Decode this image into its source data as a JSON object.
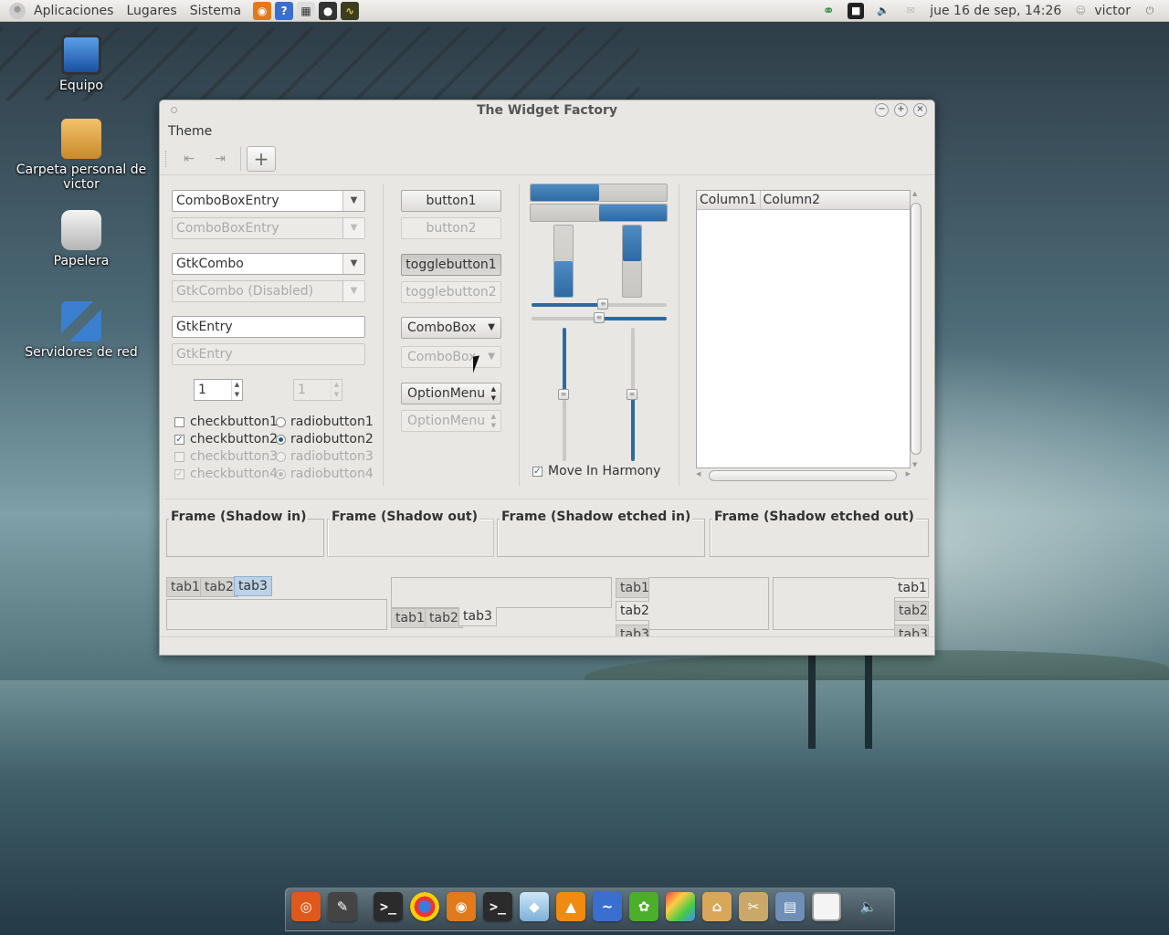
{
  "top_panel": {
    "menus": [
      "Aplicaciones",
      "Lugares",
      "Sistema"
    ],
    "datetime": "jue 16 de sep, 14:26",
    "user": "victor"
  },
  "desktop": {
    "icons": [
      {
        "label": "Equipo"
      },
      {
        "label": "Carpeta personal de victor"
      },
      {
        "label": "Papelera"
      },
      {
        "label": "Servidores de red"
      }
    ]
  },
  "window": {
    "title": "The Widget Factory",
    "menu": {
      "theme": "Theme"
    },
    "col1": {
      "combo_entry": "ComboBoxEntry",
      "combo_entry_disabled": "ComboBoxEntry",
      "gtk_combo": "GtkCombo",
      "gtk_combo_disabled": "GtkCombo (Disabled)",
      "entry": "GtkEntry",
      "entry_disabled_placeholder": "GtkEntry",
      "spin_value": "1",
      "spin_disabled_value": "1",
      "checks": [
        "checkbutton1",
        "checkbutton2",
        "checkbutton3",
        "checkbutton4"
      ],
      "radios": [
        "radiobutton1",
        "radiobutton2",
        "radiobutton3",
        "radiobutton4"
      ]
    },
    "col2": {
      "button1": "button1",
      "button2": "button2",
      "toggle1": "togglebutton1",
      "toggle2": "togglebutton2",
      "combobox": "ComboBox",
      "combobox_disabled": "ComboBox",
      "optionmenu": "OptionMenu",
      "optionmenu_disabled": "OptionMenu"
    },
    "col3": {
      "hbar1_fraction": 0.5,
      "hbar2_fraction": 0.5,
      "vbar1_fraction": 0.5,
      "vbar2_fraction": 0.5,
      "hscale1_value": 0.53,
      "hscale2_value": 0.5,
      "vscale1_value": 0.5,
      "vscale2_value": 0.5,
      "harmony_label": "Move In Harmony"
    },
    "tree": {
      "columns": [
        "Column1",
        "Column2"
      ]
    },
    "frames": [
      "Frame (Shadow in)",
      "Frame (Shadow out)",
      "Frame (Shadow etched in)",
      "Frame (Shadow etched out)"
    ],
    "notebooks": {
      "tabs": [
        "tab1",
        "tab2",
        "tab3"
      ]
    }
  },
  "colors": {
    "accent": "#2e6aa1",
    "window_bg": "#e8e7e4"
  }
}
